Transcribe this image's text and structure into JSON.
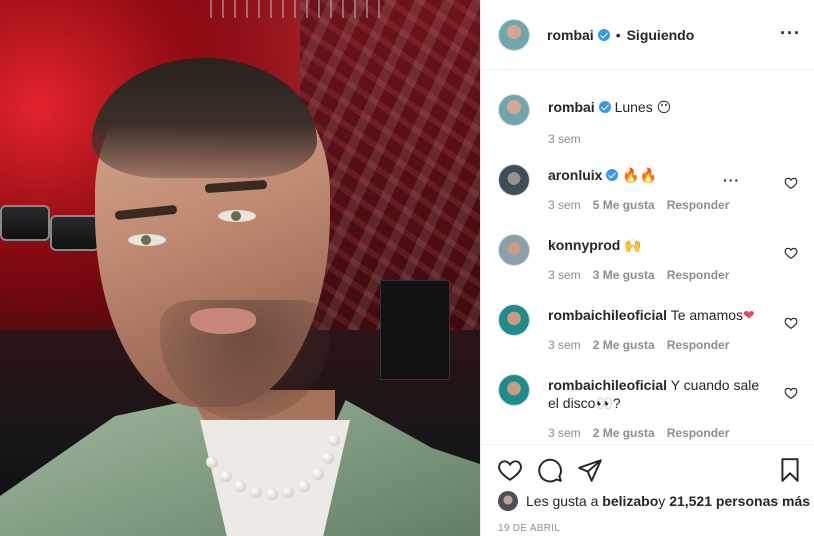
{
  "post": {
    "author": {
      "username": "rombai",
      "verified": true
    },
    "header": {
      "follow_separator": "•",
      "follow_status": "Siguiendo",
      "more_icon": "more-horizontal-icon"
    },
    "caption": {
      "username": "rombai",
      "text": "Lunes ",
      "emoji": "😶",
      "time": "3 sem"
    },
    "comments": [
      {
        "username": "aronluix",
        "verified": true,
        "text": "",
        "emoji": "🔥🔥",
        "time": "3 sem",
        "likes": "5 Me gusta",
        "reply": "Responder"
      },
      {
        "username": "konnyprod",
        "verified": false,
        "text": "",
        "emoji": "🙌",
        "time": "3 sem",
        "likes": "3 Me gusta",
        "reply": "Responder"
      },
      {
        "username": "rombaichileoficial",
        "verified": false,
        "text": "Te amamos",
        "emoji": "❤",
        "time": "3 sem",
        "likes": "2 Me gusta",
        "reply": "Responder"
      },
      {
        "username": "rombaichileoficial",
        "verified": false,
        "text": "Y cuando sale el disco",
        "emoji": "👀",
        "text_after": "?",
        "time": "3 sem",
        "likes": "2 Me gusta",
        "reply": "Responder"
      }
    ],
    "likes_summary": {
      "prefix": "Les gusta a ",
      "user": "belizabo",
      "middle": " y ",
      "count": "21,521 personas más"
    },
    "date": "19 DE ABRIL",
    "colors": {
      "verified": "#3897f0",
      "muted": "#8e8e8e",
      "text": "#262626",
      "heart_red": "#ed4956"
    },
    "icons": [
      "heart-icon",
      "comment-icon",
      "share-icon",
      "bookmark-icon"
    ]
  }
}
